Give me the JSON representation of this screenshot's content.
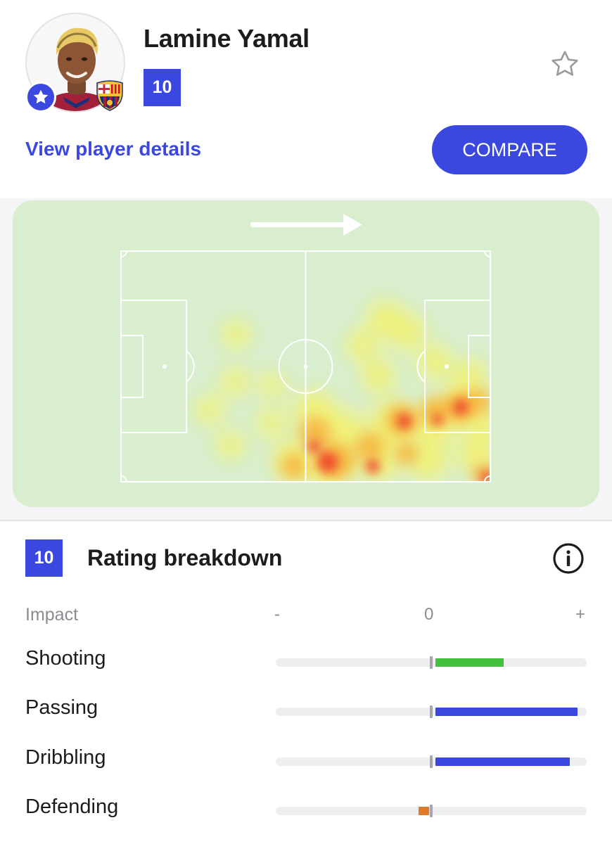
{
  "player": {
    "name": "Lamine Yamal",
    "rating": "10",
    "details_link": "View player details",
    "compare_label": "COMPARE",
    "icons": {
      "badge": "star-icon",
      "club": "club-crest-icon",
      "favorite": "star-outline-icon"
    }
  },
  "heatmap": {
    "direction": "attacking left-to-right",
    "icons": {
      "arrow": "arrow-right-icon"
    }
  },
  "rating_breakdown": {
    "rating": "10",
    "title": "Rating breakdown",
    "info_icon": "info-icon",
    "scale": {
      "label": "Impact",
      "minus": "-",
      "zero": "0",
      "plus": "+"
    },
    "stats": [
      {
        "label": "Shooting",
        "impact": 0.45,
        "color": "#44c13c"
      },
      {
        "label": "Passing",
        "impact": 0.94,
        "color": "#3b48e0"
      },
      {
        "label": "Dribbling",
        "impact": 0.89,
        "color": "#3b48e0"
      },
      {
        "label": "Defending",
        "impact": -0.07,
        "color": "#e07a2a"
      }
    ]
  },
  "colors": {
    "accent": "#3b48e0",
    "pitch": "#d8eecf",
    "positive": "#44c13c",
    "negative": "#e07a2a"
  }
}
